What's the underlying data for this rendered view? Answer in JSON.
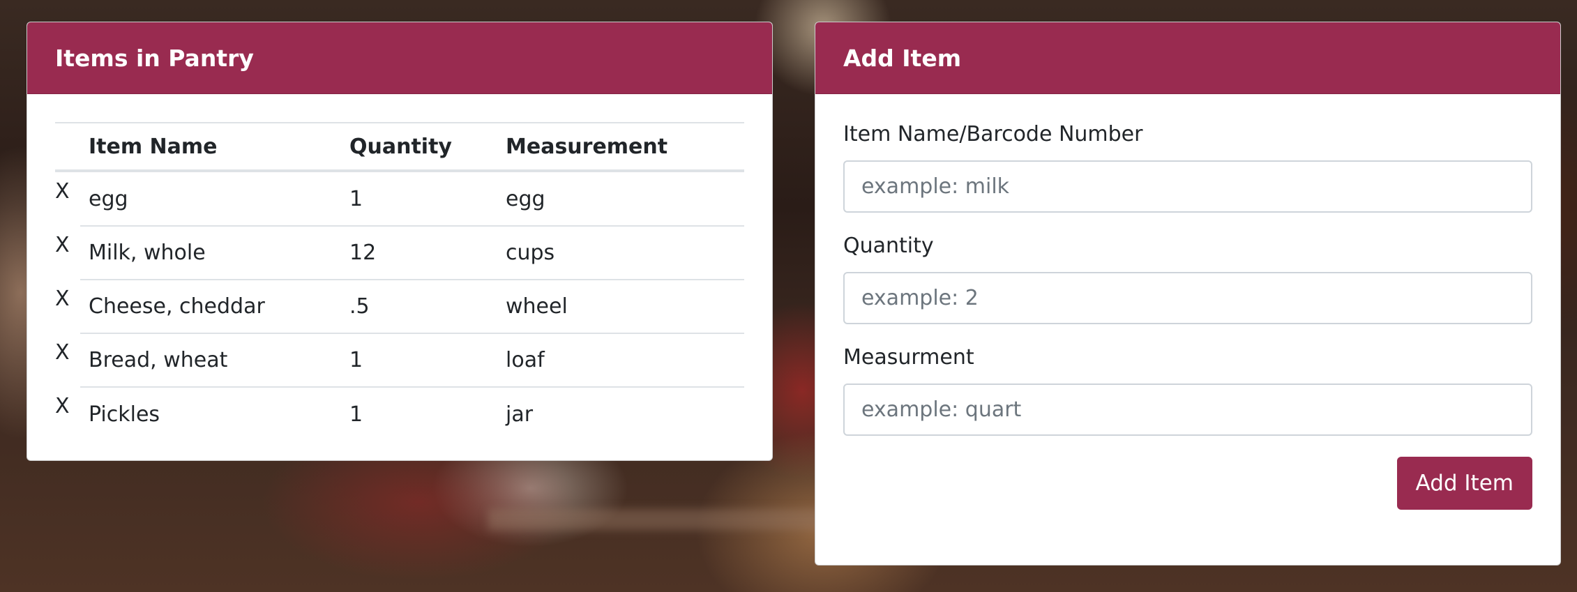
{
  "colors": {
    "accent": "#992b50",
    "card_bg": "#ffffff",
    "text": "#212529",
    "placeholder": "#6c757d"
  },
  "pantry": {
    "title": "Items in Pantry",
    "columns": [
      "",
      "Item Name",
      "Quantity",
      "Measurement"
    ],
    "delete_symbol": "X",
    "rows": [
      {
        "name": "egg",
        "quantity": "1",
        "measurement": "egg"
      },
      {
        "name": "Milk, whole",
        "quantity": "12",
        "measurement": "cups"
      },
      {
        "name": "Cheese, cheddar",
        "quantity": ".5",
        "measurement": "wheel"
      },
      {
        "name": "Bread, wheat",
        "quantity": "1",
        "measurement": "loaf"
      },
      {
        "name": "Pickles",
        "quantity": "1",
        "measurement": "jar"
      }
    ]
  },
  "add_item": {
    "title": "Add Item",
    "fields": [
      {
        "label": "Item Name/Barcode Number",
        "value": "",
        "placeholder": "example: milk"
      },
      {
        "label": "Quantity",
        "value": "",
        "placeholder": "example: 2"
      },
      {
        "label": "Measurment",
        "value": "",
        "placeholder": "example: quart"
      }
    ],
    "submit_label": "Add Item"
  }
}
